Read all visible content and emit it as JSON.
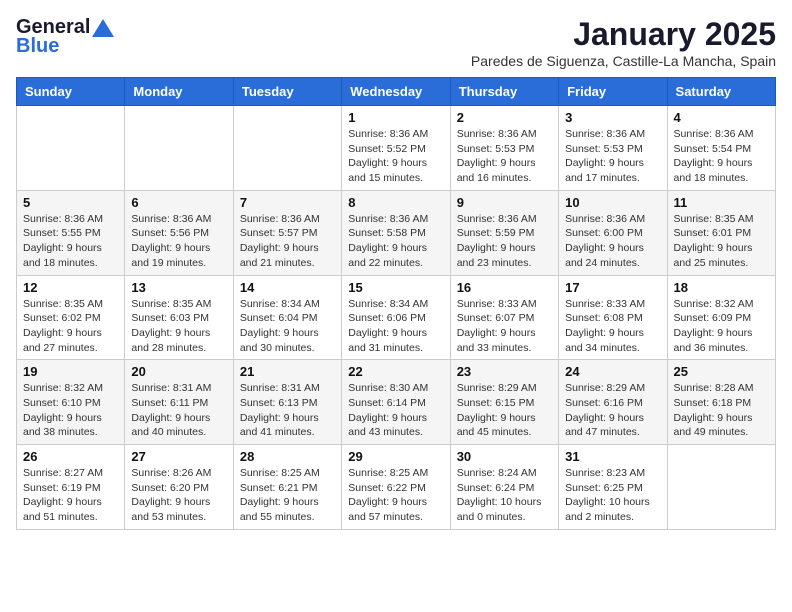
{
  "logo": {
    "general": "General",
    "blue": "Blue"
  },
  "calendar": {
    "title": "January 2025",
    "subtitle": "Paredes de Siguenza, Castille-La Mancha, Spain",
    "headers": [
      "Sunday",
      "Monday",
      "Tuesday",
      "Wednesday",
      "Thursday",
      "Friday",
      "Saturday"
    ],
    "weeks": [
      [
        {
          "day": "",
          "info": ""
        },
        {
          "day": "",
          "info": ""
        },
        {
          "day": "",
          "info": ""
        },
        {
          "day": "1",
          "info": "Sunrise: 8:36 AM\nSunset: 5:52 PM\nDaylight: 9 hours and 15 minutes."
        },
        {
          "day": "2",
          "info": "Sunrise: 8:36 AM\nSunset: 5:53 PM\nDaylight: 9 hours and 16 minutes."
        },
        {
          "day": "3",
          "info": "Sunrise: 8:36 AM\nSunset: 5:53 PM\nDaylight: 9 hours and 17 minutes."
        },
        {
          "day": "4",
          "info": "Sunrise: 8:36 AM\nSunset: 5:54 PM\nDaylight: 9 hours and 18 minutes."
        }
      ],
      [
        {
          "day": "5",
          "info": "Sunrise: 8:36 AM\nSunset: 5:55 PM\nDaylight: 9 hours and 18 minutes."
        },
        {
          "day": "6",
          "info": "Sunrise: 8:36 AM\nSunset: 5:56 PM\nDaylight: 9 hours and 19 minutes."
        },
        {
          "day": "7",
          "info": "Sunrise: 8:36 AM\nSunset: 5:57 PM\nDaylight: 9 hours and 21 minutes."
        },
        {
          "day": "8",
          "info": "Sunrise: 8:36 AM\nSunset: 5:58 PM\nDaylight: 9 hours and 22 minutes."
        },
        {
          "day": "9",
          "info": "Sunrise: 8:36 AM\nSunset: 5:59 PM\nDaylight: 9 hours and 23 minutes."
        },
        {
          "day": "10",
          "info": "Sunrise: 8:36 AM\nSunset: 6:00 PM\nDaylight: 9 hours and 24 minutes."
        },
        {
          "day": "11",
          "info": "Sunrise: 8:35 AM\nSunset: 6:01 PM\nDaylight: 9 hours and 25 minutes."
        }
      ],
      [
        {
          "day": "12",
          "info": "Sunrise: 8:35 AM\nSunset: 6:02 PM\nDaylight: 9 hours and 27 minutes."
        },
        {
          "day": "13",
          "info": "Sunrise: 8:35 AM\nSunset: 6:03 PM\nDaylight: 9 hours and 28 minutes."
        },
        {
          "day": "14",
          "info": "Sunrise: 8:34 AM\nSunset: 6:04 PM\nDaylight: 9 hours and 30 minutes."
        },
        {
          "day": "15",
          "info": "Sunrise: 8:34 AM\nSunset: 6:06 PM\nDaylight: 9 hours and 31 minutes."
        },
        {
          "day": "16",
          "info": "Sunrise: 8:33 AM\nSunset: 6:07 PM\nDaylight: 9 hours and 33 minutes."
        },
        {
          "day": "17",
          "info": "Sunrise: 8:33 AM\nSunset: 6:08 PM\nDaylight: 9 hours and 34 minutes."
        },
        {
          "day": "18",
          "info": "Sunrise: 8:32 AM\nSunset: 6:09 PM\nDaylight: 9 hours and 36 minutes."
        }
      ],
      [
        {
          "day": "19",
          "info": "Sunrise: 8:32 AM\nSunset: 6:10 PM\nDaylight: 9 hours and 38 minutes."
        },
        {
          "day": "20",
          "info": "Sunrise: 8:31 AM\nSunset: 6:11 PM\nDaylight: 9 hours and 40 minutes."
        },
        {
          "day": "21",
          "info": "Sunrise: 8:31 AM\nSunset: 6:13 PM\nDaylight: 9 hours and 41 minutes."
        },
        {
          "day": "22",
          "info": "Sunrise: 8:30 AM\nSunset: 6:14 PM\nDaylight: 9 hours and 43 minutes."
        },
        {
          "day": "23",
          "info": "Sunrise: 8:29 AM\nSunset: 6:15 PM\nDaylight: 9 hours and 45 minutes."
        },
        {
          "day": "24",
          "info": "Sunrise: 8:29 AM\nSunset: 6:16 PM\nDaylight: 9 hours and 47 minutes."
        },
        {
          "day": "25",
          "info": "Sunrise: 8:28 AM\nSunset: 6:18 PM\nDaylight: 9 hours and 49 minutes."
        }
      ],
      [
        {
          "day": "26",
          "info": "Sunrise: 8:27 AM\nSunset: 6:19 PM\nDaylight: 9 hours and 51 minutes."
        },
        {
          "day": "27",
          "info": "Sunrise: 8:26 AM\nSunset: 6:20 PM\nDaylight: 9 hours and 53 minutes."
        },
        {
          "day": "28",
          "info": "Sunrise: 8:25 AM\nSunset: 6:21 PM\nDaylight: 9 hours and 55 minutes."
        },
        {
          "day": "29",
          "info": "Sunrise: 8:25 AM\nSunset: 6:22 PM\nDaylight: 9 hours and 57 minutes."
        },
        {
          "day": "30",
          "info": "Sunrise: 8:24 AM\nSunset: 6:24 PM\nDaylight: 10 hours and 0 minutes."
        },
        {
          "day": "31",
          "info": "Sunrise: 8:23 AM\nSunset: 6:25 PM\nDaylight: 10 hours and 2 minutes."
        },
        {
          "day": "",
          "info": ""
        }
      ]
    ]
  }
}
